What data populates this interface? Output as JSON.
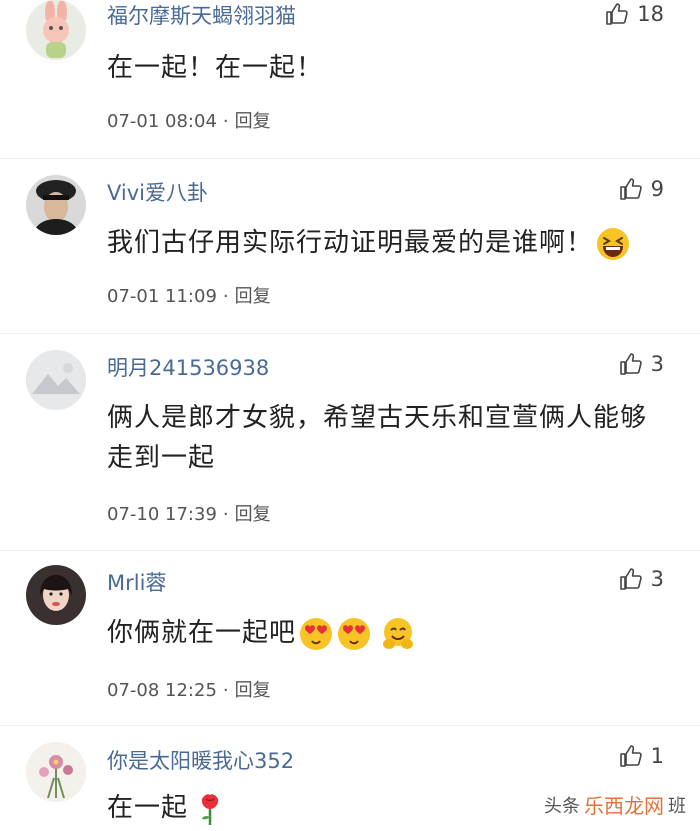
{
  "comments": [
    {
      "username": "福尔摩斯天蝎翎羽猫",
      "likes": "18",
      "text": "在一起！在一起！",
      "time": "07-01 08:04",
      "separator": "·",
      "reply": "回复",
      "avatar_icon": "cartoon-rabbit-avatar"
    },
    {
      "username": "Vivi爱八卦",
      "likes": "9",
      "text": "我们古仔用实际行动证明最爱的是谁啊！",
      "emoji": [
        "grinning-squint-face"
      ],
      "time": "07-01 11:09",
      "separator": "·",
      "reply": "回复",
      "avatar_icon": "man-in-cap-avatar"
    },
    {
      "username": "明月241536938",
      "likes": "3",
      "text": "俩人是郎才女貌，希望古天乐和宣萱俩人能够走到一起",
      "time": "07-10 17:39",
      "separator": "·",
      "reply": "回复",
      "avatar_icon": "mountain-landscape-avatar"
    },
    {
      "username": "Mrli蓉",
      "likes": "3",
      "text": "你俩就在一起吧",
      "emoji": [
        "heart-eyes-face",
        "heart-eyes-face",
        "hugging-face"
      ],
      "time": "07-08 12:25",
      "separator": "·",
      "reply": "回复",
      "avatar_icon": "woman-portrait-avatar"
    },
    {
      "username": "你是太阳暖我心352",
      "likes": "1",
      "text": "在一起",
      "emoji": [
        "rose"
      ],
      "avatar_icon": "flower-avatar"
    }
  ],
  "watermark": {
    "left": "头条",
    "middle": "乐西龙网",
    "right": "班"
  },
  "colors": {
    "username": "#4a6a96",
    "text": "#222222",
    "meta": "#555555"
  }
}
